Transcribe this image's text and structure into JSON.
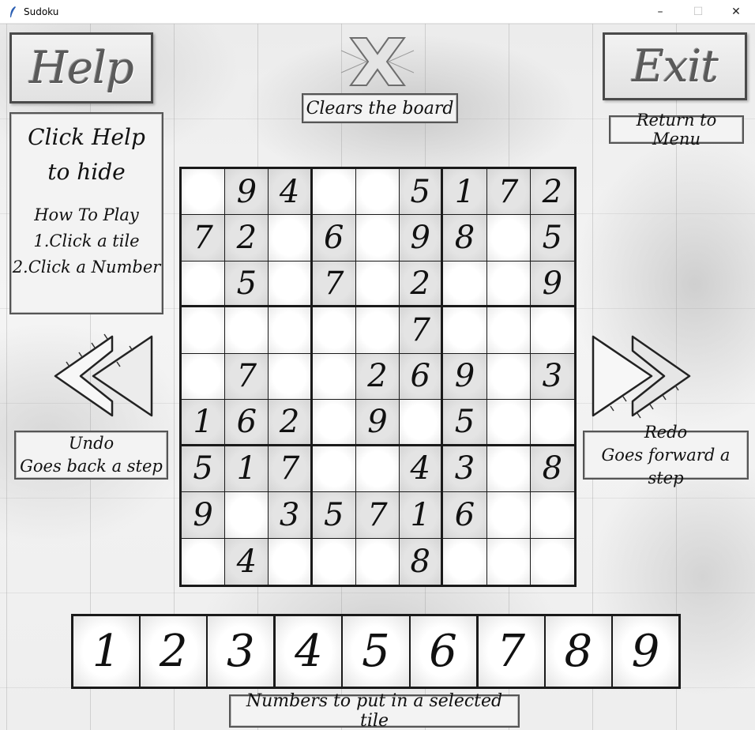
{
  "window": {
    "title": "Sudoku",
    "app_icon": "feather-icon",
    "controls": {
      "minimize": "–",
      "maximize": "☐",
      "close": "✕"
    }
  },
  "toolbar": {
    "help_label": "Help",
    "exit_label": "Exit",
    "clear_icon": "clear-board-x-icon",
    "clear_caption": "Clears the board",
    "exit_caption": "Return to Menu"
  },
  "help_panel": {
    "title_line1": "Click Help",
    "title_line2": "to hide",
    "heading": "How To Play",
    "step1": "1.Click a tile",
    "step2": "2.Click a Number"
  },
  "undo": {
    "icon": "rewind-double-arrow-icon",
    "title": "Undo",
    "caption": "Goes back a step"
  },
  "redo": {
    "icon": "fast-forward-double-arrow-icon",
    "title": "Redo",
    "caption": "Goes forward a step"
  },
  "board": {
    "rows": [
      [
        "",
        "9",
        "4",
        "",
        "",
        "5",
        "1",
        "7",
        "2"
      ],
      [
        "7",
        "2",
        "",
        "6",
        "",
        "9",
        "8",
        "",
        "5"
      ],
      [
        "",
        "5",
        "",
        "7",
        "",
        "2",
        "",
        "",
        "9"
      ],
      [
        "",
        "",
        "",
        "",
        "",
        "7",
        "",
        "",
        ""
      ],
      [
        "",
        "7",
        "",
        "",
        "2",
        "6",
        "9",
        "",
        "3"
      ],
      [
        "1",
        "6",
        "2",
        "",
        "9",
        "",
        "5",
        "",
        ""
      ],
      [
        "5",
        "1",
        "7",
        "",
        "",
        "4",
        "3",
        "",
        "8"
      ],
      [
        "9",
        "",
        "3",
        "5",
        "7",
        "1",
        "6",
        "",
        ""
      ],
      [
        "",
        "4",
        "",
        "",
        "",
        "8",
        "",
        "",
        ""
      ]
    ]
  },
  "palette": {
    "numbers": [
      "1",
      "2",
      "3",
      "4",
      "5",
      "6",
      "7",
      "8",
      "9"
    ],
    "caption": "Numbers to put in a selected tile"
  }
}
